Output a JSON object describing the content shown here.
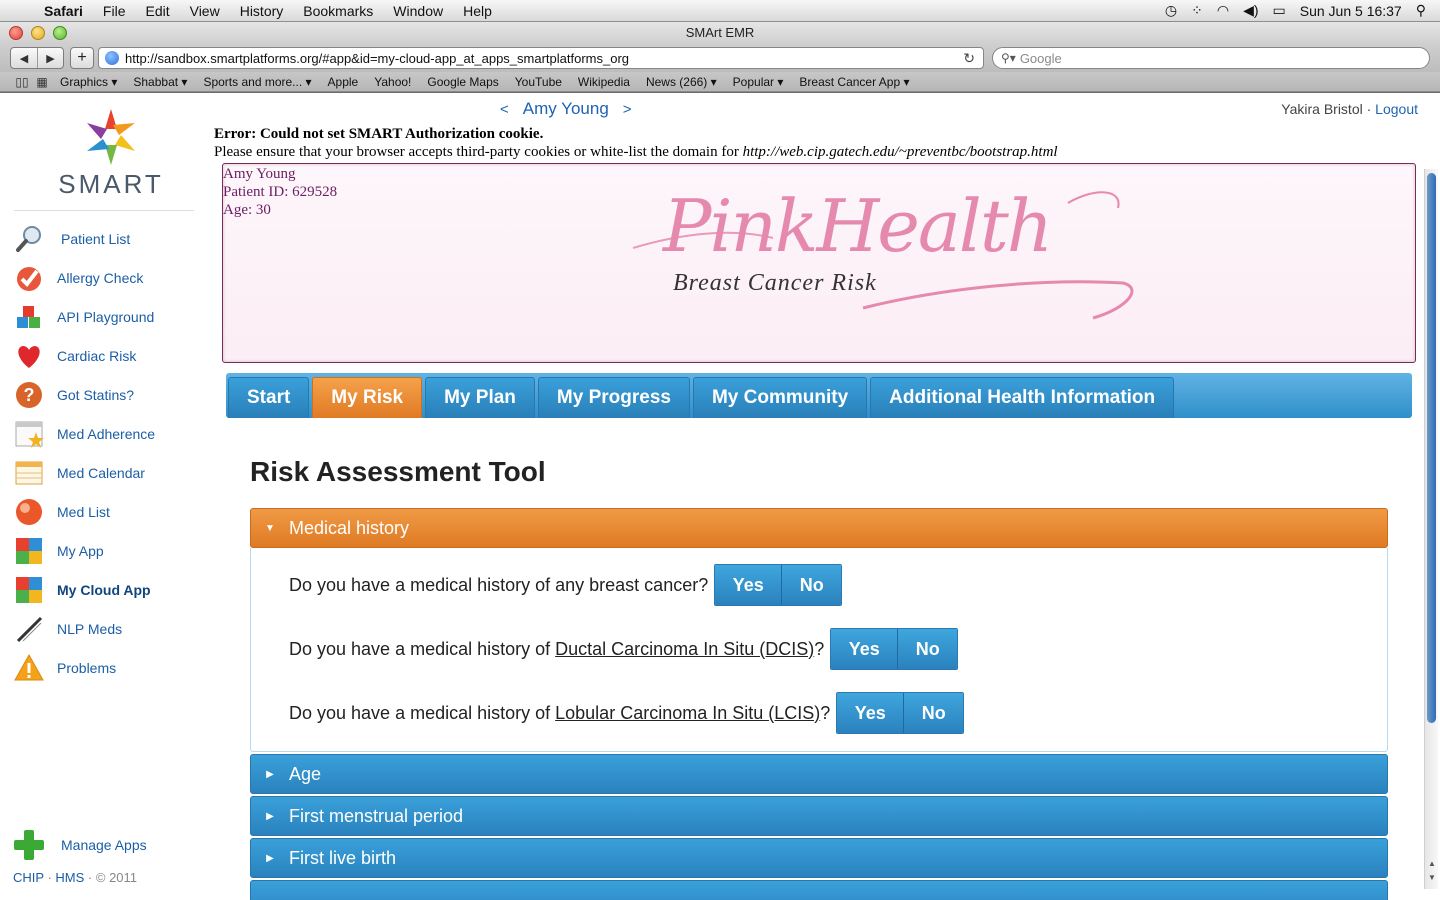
{
  "menubar": {
    "apple": "",
    "app": "Safari",
    "items": [
      "File",
      "Edit",
      "View",
      "History",
      "Bookmarks",
      "Window",
      "Help"
    ],
    "clock": "Sun Jun 5  16:37"
  },
  "window": {
    "title": "SMArt EMR"
  },
  "toolbar": {
    "url": "http://sandbox.smartplatforms.org/#app&id=my-cloud-app_at_apps_smartplatforms_org",
    "search_placeholder": "Google"
  },
  "bookmarks": [
    "Graphics ▾",
    "Shabbat ▾",
    "Sports and more... ▾",
    "Apple",
    "Yahoo!",
    "Google Maps",
    "YouTube",
    "Wikipedia",
    "News (266) ▾",
    "Popular ▾",
    "Breast Cancer App ▾"
  ],
  "sidebar": {
    "logo_text": "SMART",
    "apps": [
      {
        "label": "Patient List",
        "icon": "magnifier-icon"
      },
      {
        "label": "Allergy Check",
        "icon": "checkmark-icon"
      },
      {
        "label": "API Playground",
        "icon": "blocks-icon"
      },
      {
        "label": "Cardiac Risk",
        "icon": "heart-icon"
      },
      {
        "label": "Got Statins?",
        "icon": "question-icon"
      },
      {
        "label": "Med Adherence",
        "icon": "calendar-star-icon"
      },
      {
        "label": "Med Calendar",
        "icon": "calendar-icon"
      },
      {
        "label": "Med List",
        "icon": "pill-icon"
      },
      {
        "label": "My App",
        "icon": "grid-icon"
      },
      {
        "label": "My Cloud App",
        "icon": "grid-icon"
      },
      {
        "label": "NLP Meds",
        "icon": "pen-icon"
      },
      {
        "label": "Problems",
        "icon": "warning-icon"
      }
    ],
    "manage_label": "Manage Apps",
    "footer": {
      "chip": "CHIP",
      "hms": "HMS",
      "copyright": "© 2011"
    }
  },
  "patient_nav": {
    "prev": "<",
    "name": "Amy Young",
    "next": ">"
  },
  "user": {
    "name": "Yakira Bristol",
    "sep": "·",
    "logout": "Logout"
  },
  "error": {
    "title": "Error: Could not set SMART Authorization cookie.",
    "message": "Please ensure that your browser accepts third-party cookies or white-list the domain for",
    "domain": "http://web.cip.gatech.edu/~preventbc/bootstrap.html"
  },
  "patient": {
    "name": "Amy Young",
    "id_line": "Patient ID: 629528",
    "age_line": "Age: 30"
  },
  "brand": {
    "title": "PinkHealth",
    "subtitle": "Breast Cancer Risk"
  },
  "tabs": [
    "Start",
    "My Risk",
    "My Plan",
    "My Progress",
    "My Community",
    "Additional Health Information"
  ],
  "active_tab": "My Risk",
  "page_title": "Risk Assessment Tool",
  "sections": [
    {
      "label": "Medical history",
      "open": true
    },
    {
      "label": "Age",
      "open": false
    },
    {
      "label": "First menstrual period",
      "open": false
    },
    {
      "label": "First live birth",
      "open": false
    }
  ],
  "questions": [
    {
      "prefix": "Do you have a medical history of any breast cancer?",
      "link": "",
      "suffix": ""
    },
    {
      "prefix": "Do you have a medical history of ",
      "link": "Ductal Carcinoma In Situ (DCIS)",
      "suffix": "?"
    },
    {
      "prefix": "Do you have a medical history of ",
      "link": "Lobular Carcinoma In Situ (LCIS)",
      "suffix": "?"
    }
  ],
  "buttons": {
    "yes": "Yes",
    "no": "No"
  },
  "colors": {
    "accent_blue": "#2a82bd",
    "accent_orange": "#e07a25",
    "brand_pink": "#e58aae",
    "link_blue": "#1f63b3"
  }
}
